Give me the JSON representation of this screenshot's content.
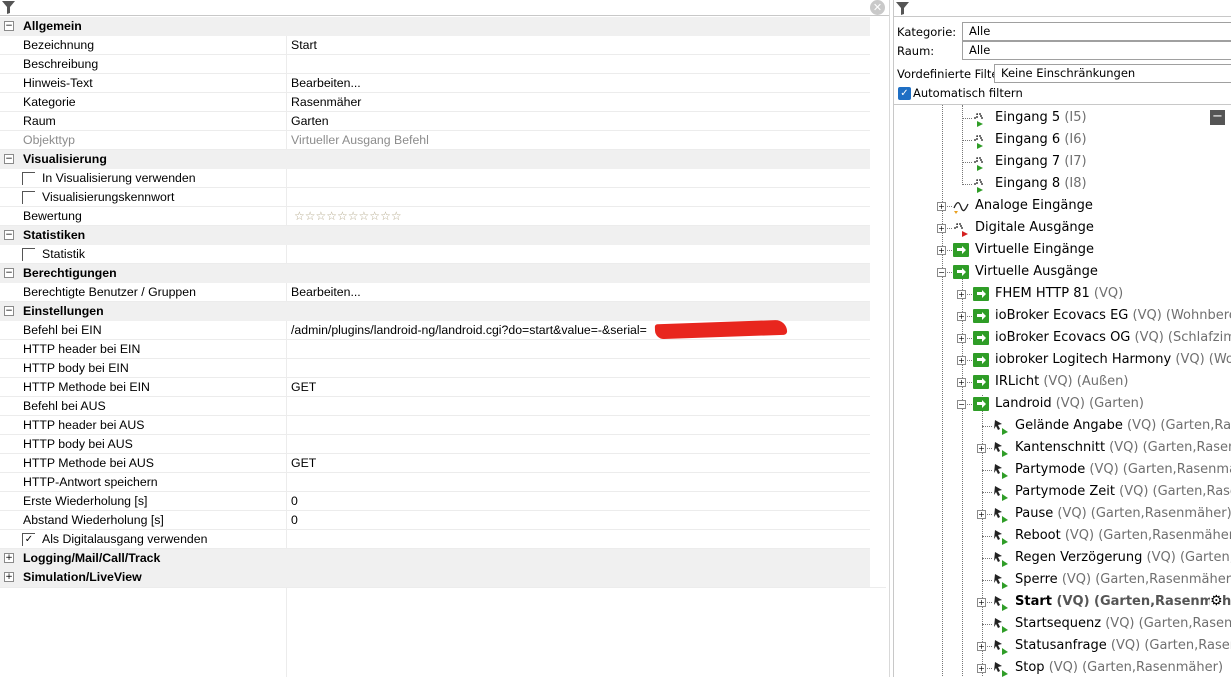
{
  "categories": [
    {
      "id": "allgemein",
      "title": "Allgemein",
      "expanded": true,
      "rows": [
        {
          "name": "Bezeichnung",
          "value": "Start"
        },
        {
          "name": "Beschreibung",
          "value": ""
        },
        {
          "name": "Hinweis-Text",
          "value": "Bearbeiten..."
        },
        {
          "name": "Kategorie",
          "value": "Rasenmäher"
        },
        {
          "name": "Raum",
          "value": "Garten"
        },
        {
          "name": "Objekttyp",
          "value": "Virtueller Ausgang Befehl",
          "dim": true
        }
      ]
    },
    {
      "id": "visualisierung",
      "title": "Visualisierung",
      "expanded": true,
      "rows": [
        {
          "type": "check",
          "name": "In Visualisierung verwenden",
          "checked": false
        },
        {
          "type": "check",
          "name": "Visualisierungskennwort",
          "checked": false
        },
        {
          "type": "stars",
          "name": "Bewertung",
          "value": 0,
          "max": 10
        }
      ]
    },
    {
      "id": "statistiken",
      "title": "Statistiken",
      "expanded": true,
      "rows": [
        {
          "type": "check",
          "name": "Statistik",
          "checked": false
        }
      ]
    },
    {
      "id": "berechtigungen",
      "title": "Berechtigungen",
      "expanded": true,
      "rows": [
        {
          "name": "Berechtigte Benutzer / Gruppen",
          "value": "Bearbeiten..."
        }
      ]
    },
    {
      "id": "einstellungen",
      "title": "Einstellungen",
      "expanded": true,
      "rows": [
        {
          "name": "Befehl bei EIN",
          "value": "/admin/plugins/landroid-ng/landroid.cgi?do=start&value=-&serial=",
          "redacted": true
        },
        {
          "name": "HTTP header bei EIN",
          "value": ""
        },
        {
          "name": "HTTP body bei EIN",
          "value": ""
        },
        {
          "name": "HTTP Methode bei EIN",
          "value": "GET"
        },
        {
          "name": "Befehl bei AUS",
          "value": ""
        },
        {
          "name": "HTTP header bei AUS",
          "value": ""
        },
        {
          "name": "HTTP body bei AUS",
          "value": ""
        },
        {
          "name": "HTTP Methode bei AUS",
          "value": "GET"
        },
        {
          "name": "HTTP-Antwort speichern",
          "value": ""
        },
        {
          "name": "Erste Wiederholung [s]",
          "value": "0"
        },
        {
          "name": "Abstand Wiederholung [s]",
          "value": "0"
        },
        {
          "type": "check",
          "name": "Als Digitalausgang verwenden",
          "checked": true
        }
      ]
    },
    {
      "id": "logging",
      "title": "Logging/Mail/Call/Track",
      "expanded": false,
      "rows": []
    },
    {
      "id": "simulation",
      "title": "Simulation/LiveView",
      "expanded": false,
      "rows": []
    }
  ],
  "filter": {
    "kategorie_label": "Kategorie:",
    "kategorie_value": "Alle",
    "raum_label": "Raum:",
    "raum_value": "Alle",
    "vordef_label": "Vordefinierte Filter",
    "vordef_value": "Keine Einschränkungen",
    "auto_label": "Automatisch filtern",
    "auto_checked": true
  },
  "tree": [
    {
      "label": "Eingang 5",
      "meta": "(I5)",
      "level": 2,
      "icon": "digital-input-icon",
      "exp": null
    },
    {
      "label": "Eingang 6",
      "meta": "(I6)",
      "level": 2,
      "icon": "digital-input-icon",
      "exp": null
    },
    {
      "label": "Eingang 7",
      "meta": "(I7)",
      "level": 2,
      "icon": "digital-input-icon",
      "exp": null
    },
    {
      "label": "Eingang 8",
      "meta": "(I8)",
      "level": 2,
      "icon": "digital-input-icon",
      "exp": null
    },
    {
      "label": "Analoge Eingänge",
      "meta": "",
      "level": 1,
      "icon": "analog-input-icon",
      "exp": "+"
    },
    {
      "label": "Digitale Ausgänge",
      "meta": "",
      "level": 1,
      "icon": "digital-output-icon",
      "exp": "+"
    },
    {
      "label": "Virtuelle Eingänge",
      "meta": "",
      "level": 1,
      "icon": "virtual-input-icon",
      "exp": "+"
    },
    {
      "label": "Virtuelle Ausgänge",
      "meta": "",
      "level": 1,
      "icon": "virtual-output-icon",
      "exp": "-"
    },
    {
      "label": "FHEM HTTP 81",
      "meta": "(VQ)",
      "level": 2,
      "icon": "virtual-output-icon",
      "exp": "+"
    },
    {
      "label": "ioBroker Ecovacs EG",
      "meta": "(VQ) (Wohnbereich",
      "level": 2,
      "icon": "virtual-output-icon",
      "exp": "+"
    },
    {
      "label": "ioBroker Ecovacs OG",
      "meta": "(VQ) (Schlafzimm",
      "level": 2,
      "icon": "virtual-output-icon",
      "exp": "+"
    },
    {
      "label": "iobroker Logitech Harmony",
      "meta": "(VQ) (Woh",
      "level": 2,
      "icon": "virtual-output-icon",
      "exp": "+"
    },
    {
      "label": "IRLicht",
      "meta": "(VQ) (Außen)",
      "level": 2,
      "icon": "virtual-output-icon",
      "exp": "+"
    },
    {
      "label": "Landroid",
      "meta": "(VQ) (Garten)",
      "level": 2,
      "icon": "virtual-output-icon",
      "exp": "-"
    },
    {
      "label": "Gelände Angabe",
      "meta": "(VQ) (Garten,Rase",
      "level": 3,
      "icon": "command-icon",
      "exp": null
    },
    {
      "label": "Kantenschnitt",
      "meta": "(VQ) (Garten,Rasenm",
      "level": 3,
      "icon": "command-icon",
      "exp": "+"
    },
    {
      "label": "Partymode",
      "meta": "(VQ) (Garten,Rasenmäh",
      "level": 3,
      "icon": "command-icon",
      "exp": null
    },
    {
      "label": "Partymode Zeit",
      "meta": "(VQ) (Garten,Rasen",
      "level": 3,
      "icon": "command-icon",
      "exp": null
    },
    {
      "label": "Pause",
      "meta": "(VQ) (Garten,Rasenmäher)",
      "level": 3,
      "icon": "command-icon",
      "exp": "+"
    },
    {
      "label": "Reboot",
      "meta": "(VQ) (Garten,Rasenmäher)",
      "level": 3,
      "icon": "command-icon",
      "exp": null
    },
    {
      "label": "Regen Verzögerung",
      "meta": "(VQ) (Garten,R",
      "level": 3,
      "icon": "command-icon",
      "exp": null
    },
    {
      "label": "Sperre",
      "meta": "(VQ) (Garten,Rasenmäher)",
      "level": 3,
      "icon": "command-icon",
      "exp": null
    },
    {
      "label": "Start",
      "meta": "(VQ) (Garten,Rasenmähe",
      "level": 3,
      "icon": "command-icon",
      "exp": "+",
      "selected": true
    },
    {
      "label": "Startsequenz",
      "meta": "(VQ) (Garten,Rasenm",
      "level": 3,
      "icon": "command-icon",
      "exp": null
    },
    {
      "label": "Statusanfrage",
      "meta": "(VQ) (Garten,Rasenm",
      "level": 3,
      "icon": "command-icon",
      "exp": "+"
    },
    {
      "label": "Stop",
      "meta": "(VQ) (Garten,Rasenmäher)",
      "level": 3,
      "icon": "command-icon",
      "exp": "+"
    }
  ],
  "icons": {
    "filter": "filter-icon",
    "clear": "clear-icon",
    "collapse": "minus-icon",
    "settings": "gear-icon"
  },
  "colors": {
    "accent": "#1f6fc4",
    "virtual_icon": "#2f9d27",
    "redaction": "#e8261e",
    "category_bg": "#f0f0f0"
  }
}
